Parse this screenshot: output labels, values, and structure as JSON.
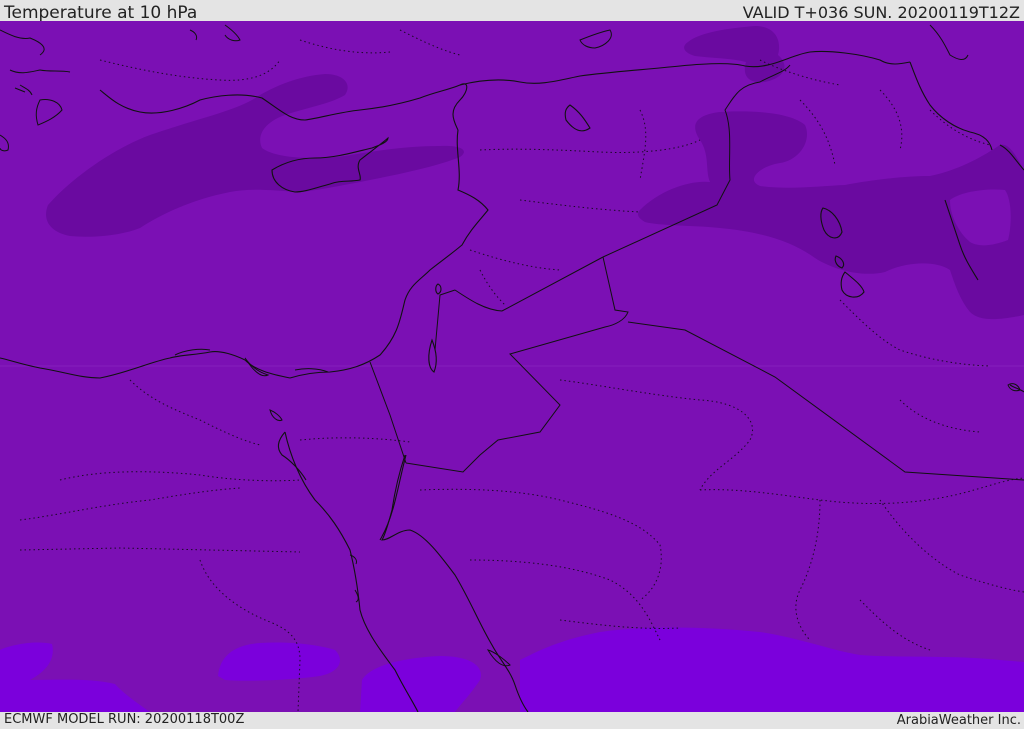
{
  "header": {
    "title": "Temperature at 10 hPa",
    "valid": "VALID T+036 SUN. 20200119T12Z"
  },
  "footer": {
    "model_run": "ECMWF MODEL RUN: 20200118T00Z",
    "credit": "ArabiaWeather Inc."
  },
  "colors": {
    "base": "#7b10b4",
    "cold": "#6a0aa0",
    "warm": "#7b00dc",
    "coast": "#111111",
    "chrome": "#e4e4e4"
  }
}
